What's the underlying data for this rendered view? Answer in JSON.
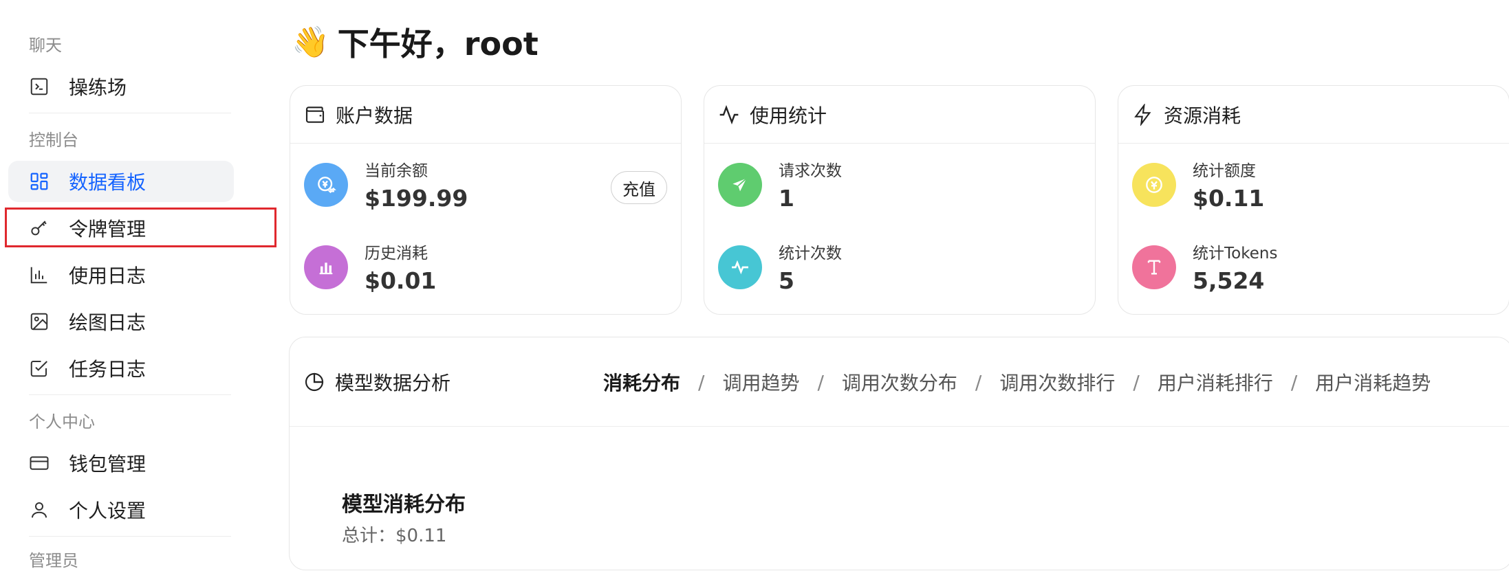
{
  "sidebar": {
    "sections": {
      "chat": "聊天",
      "console": "控制台",
      "personal": "个人中心",
      "admin_partial": "管理员"
    },
    "items": [
      {
        "label": "操练场",
        "icon": "terminal-icon"
      },
      {
        "label": "数据看板",
        "icon": "dashboard-icon",
        "active": true
      },
      {
        "label": "令牌管理",
        "icon": "key-icon"
      },
      {
        "label": "使用日志",
        "icon": "bar-chart-icon"
      },
      {
        "label": "绘图日志",
        "icon": "image-icon"
      },
      {
        "label": "任务日志",
        "icon": "checkbox-icon"
      },
      {
        "label": "钱包管理",
        "icon": "credit-card-icon"
      },
      {
        "label": "个人设置",
        "icon": "user-icon"
      }
    ]
  },
  "greeting": {
    "emoji": "👋",
    "text": "下午好，root"
  },
  "cards": {
    "account": {
      "title": "账户数据",
      "balance_label": "当前余额",
      "balance_value": "$199.99",
      "recharge_label": "充值",
      "history_label": "历史消耗",
      "history_value": "$0.01"
    },
    "usage": {
      "title": "使用统计",
      "requests_label": "请求次数",
      "requests_value": "1",
      "stat_count_label": "统计次数",
      "stat_count_value": "5"
    },
    "resource": {
      "title": "资源消耗",
      "quota_label": "统计额度",
      "quota_value": "$0.11",
      "tokens_label": "统计Tokens",
      "tokens_value": "5,524"
    }
  },
  "analysis": {
    "title": "模型数据分析",
    "tabs": [
      "消耗分布",
      "调用趋势",
      "调用次数分布",
      "调用次数排行",
      "用户消耗排行",
      "用户消耗趋势"
    ],
    "separator": "/",
    "chart_title": "模型消耗分布",
    "chart_total": "总计：$0.11"
  },
  "colors": {
    "accent": "#1664ff",
    "balance_icon": "#5aa9f5",
    "history_icon": "#c56fd6",
    "requests_icon": "#5fcc6f",
    "stat_count_icon": "#47c6d4",
    "quota_icon": "#f7e35c",
    "tokens_icon": "#f0739b",
    "highlight": "#e0282e"
  }
}
